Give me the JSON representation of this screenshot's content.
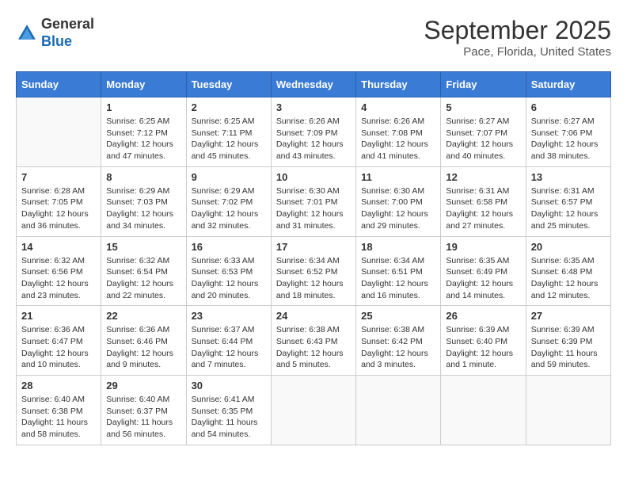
{
  "logo": {
    "general": "General",
    "blue": "Blue"
  },
  "header": {
    "month": "September 2025",
    "location": "Pace, Florida, United States"
  },
  "weekdays": [
    "Sunday",
    "Monday",
    "Tuesday",
    "Wednesday",
    "Thursday",
    "Friday",
    "Saturday"
  ],
  "weeks": [
    [
      {
        "day": "",
        "info": ""
      },
      {
        "day": "1",
        "info": "Sunrise: 6:25 AM\nSunset: 7:12 PM\nDaylight: 12 hours\nand 47 minutes."
      },
      {
        "day": "2",
        "info": "Sunrise: 6:25 AM\nSunset: 7:11 PM\nDaylight: 12 hours\nand 45 minutes."
      },
      {
        "day": "3",
        "info": "Sunrise: 6:26 AM\nSunset: 7:09 PM\nDaylight: 12 hours\nand 43 minutes."
      },
      {
        "day": "4",
        "info": "Sunrise: 6:26 AM\nSunset: 7:08 PM\nDaylight: 12 hours\nand 41 minutes."
      },
      {
        "day": "5",
        "info": "Sunrise: 6:27 AM\nSunset: 7:07 PM\nDaylight: 12 hours\nand 40 minutes."
      },
      {
        "day": "6",
        "info": "Sunrise: 6:27 AM\nSunset: 7:06 PM\nDaylight: 12 hours\nand 38 minutes."
      }
    ],
    [
      {
        "day": "7",
        "info": "Sunrise: 6:28 AM\nSunset: 7:05 PM\nDaylight: 12 hours\nand 36 minutes."
      },
      {
        "day": "8",
        "info": "Sunrise: 6:29 AM\nSunset: 7:03 PM\nDaylight: 12 hours\nand 34 minutes."
      },
      {
        "day": "9",
        "info": "Sunrise: 6:29 AM\nSunset: 7:02 PM\nDaylight: 12 hours\nand 32 minutes."
      },
      {
        "day": "10",
        "info": "Sunrise: 6:30 AM\nSunset: 7:01 PM\nDaylight: 12 hours\nand 31 minutes."
      },
      {
        "day": "11",
        "info": "Sunrise: 6:30 AM\nSunset: 7:00 PM\nDaylight: 12 hours\nand 29 minutes."
      },
      {
        "day": "12",
        "info": "Sunrise: 6:31 AM\nSunset: 6:58 PM\nDaylight: 12 hours\nand 27 minutes."
      },
      {
        "day": "13",
        "info": "Sunrise: 6:31 AM\nSunset: 6:57 PM\nDaylight: 12 hours\nand 25 minutes."
      }
    ],
    [
      {
        "day": "14",
        "info": "Sunrise: 6:32 AM\nSunset: 6:56 PM\nDaylight: 12 hours\nand 23 minutes."
      },
      {
        "day": "15",
        "info": "Sunrise: 6:32 AM\nSunset: 6:54 PM\nDaylight: 12 hours\nand 22 minutes."
      },
      {
        "day": "16",
        "info": "Sunrise: 6:33 AM\nSunset: 6:53 PM\nDaylight: 12 hours\nand 20 minutes."
      },
      {
        "day": "17",
        "info": "Sunrise: 6:34 AM\nSunset: 6:52 PM\nDaylight: 12 hours\nand 18 minutes."
      },
      {
        "day": "18",
        "info": "Sunrise: 6:34 AM\nSunset: 6:51 PM\nDaylight: 12 hours\nand 16 minutes."
      },
      {
        "day": "19",
        "info": "Sunrise: 6:35 AM\nSunset: 6:49 PM\nDaylight: 12 hours\nand 14 minutes."
      },
      {
        "day": "20",
        "info": "Sunrise: 6:35 AM\nSunset: 6:48 PM\nDaylight: 12 hours\nand 12 minutes."
      }
    ],
    [
      {
        "day": "21",
        "info": "Sunrise: 6:36 AM\nSunset: 6:47 PM\nDaylight: 12 hours\nand 10 minutes."
      },
      {
        "day": "22",
        "info": "Sunrise: 6:36 AM\nSunset: 6:46 PM\nDaylight: 12 hours\nand 9 minutes."
      },
      {
        "day": "23",
        "info": "Sunrise: 6:37 AM\nSunset: 6:44 PM\nDaylight: 12 hours\nand 7 minutes."
      },
      {
        "day": "24",
        "info": "Sunrise: 6:38 AM\nSunset: 6:43 PM\nDaylight: 12 hours\nand 5 minutes."
      },
      {
        "day": "25",
        "info": "Sunrise: 6:38 AM\nSunset: 6:42 PM\nDaylight: 12 hours\nand 3 minutes."
      },
      {
        "day": "26",
        "info": "Sunrise: 6:39 AM\nSunset: 6:40 PM\nDaylight: 12 hours\nand 1 minute."
      },
      {
        "day": "27",
        "info": "Sunrise: 6:39 AM\nSunset: 6:39 PM\nDaylight: 11 hours\nand 59 minutes."
      }
    ],
    [
      {
        "day": "28",
        "info": "Sunrise: 6:40 AM\nSunset: 6:38 PM\nDaylight: 11 hours\nand 58 minutes."
      },
      {
        "day": "29",
        "info": "Sunrise: 6:40 AM\nSunset: 6:37 PM\nDaylight: 11 hours\nand 56 minutes."
      },
      {
        "day": "30",
        "info": "Sunrise: 6:41 AM\nSunset: 6:35 PM\nDaylight: 11 hours\nand 54 minutes."
      },
      {
        "day": "",
        "info": ""
      },
      {
        "day": "",
        "info": ""
      },
      {
        "day": "",
        "info": ""
      },
      {
        "day": "",
        "info": ""
      }
    ]
  ]
}
